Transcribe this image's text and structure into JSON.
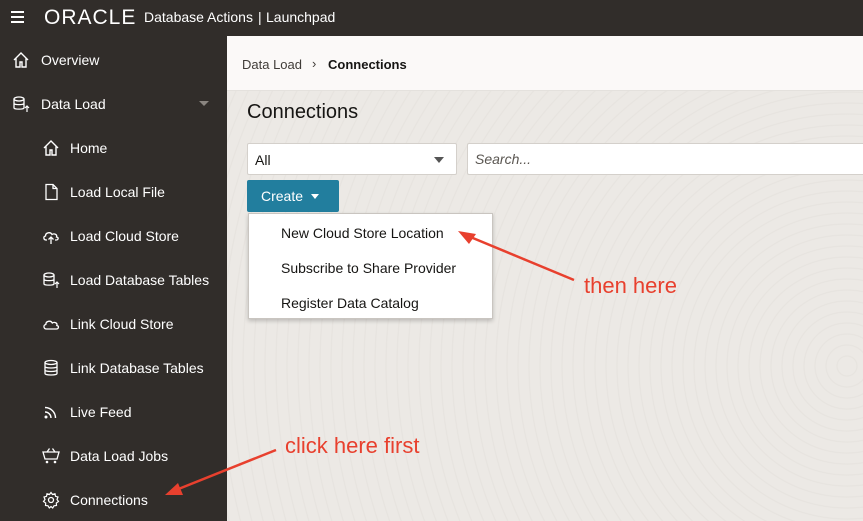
{
  "header": {
    "logo_text": "ORACLE",
    "app_title": "Database Actions",
    "separator": "|",
    "sub_title": "Launchpad"
  },
  "sidebar": {
    "items": [
      {
        "label": "Overview",
        "icon": "home-icon"
      },
      {
        "label": "Data Load",
        "icon": "database-upload-icon",
        "expanded": true
      },
      {
        "label": "Home",
        "icon": "home-icon"
      },
      {
        "label": "Load Local File",
        "icon": "file-icon"
      },
      {
        "label": "Load Cloud Store",
        "icon": "cloud-upload-icon"
      },
      {
        "label": "Load Database Tables",
        "icon": "database-upload-icon"
      },
      {
        "label": "Link Cloud Store",
        "icon": "cloud-icon"
      },
      {
        "label": "Link Database Tables",
        "icon": "database-icon"
      },
      {
        "label": "Live Feed",
        "icon": "rss-feed-icon"
      },
      {
        "label": "Data Load Jobs",
        "icon": "cart-icon"
      },
      {
        "label": "Connections",
        "icon": "gear-icon"
      }
    ]
  },
  "breadcrumb": {
    "parent": "Data Load",
    "separator": "›",
    "current": "Connections"
  },
  "main": {
    "title": "Connections",
    "filter_value": "All",
    "search_placeholder": "Search...",
    "create_label": "Create",
    "create_color": "#227e9e"
  },
  "dropdown": {
    "items": [
      "New Cloud Store Location",
      "Subscribe to Share Provider",
      "Register Data Catalog"
    ]
  },
  "annotations": {
    "first": "click here first",
    "then": "then here",
    "color": "#e8402e"
  }
}
